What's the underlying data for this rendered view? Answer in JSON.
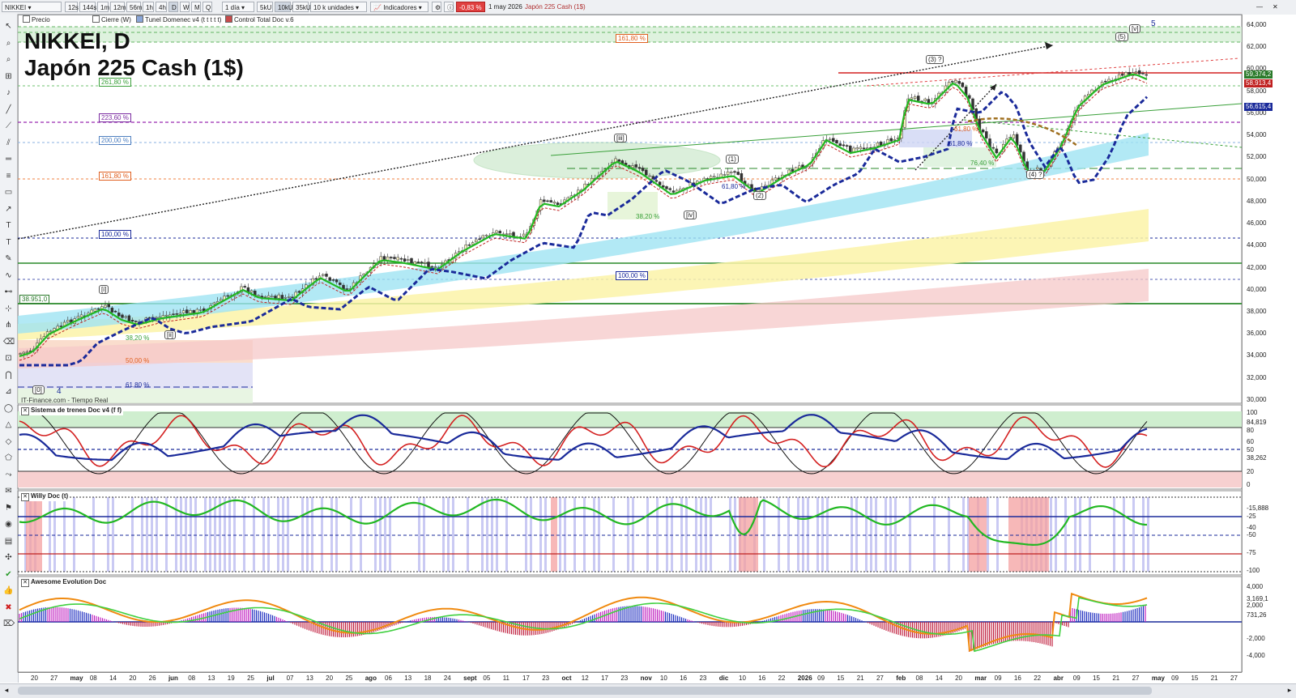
{
  "toolbar": {
    "symbol": "NIKKEI",
    "intervals": [
      "12s",
      "144s",
      "1m",
      "12m",
      "56m",
      "1h",
      "4h",
      "D",
      "W",
      "M",
      "Q"
    ],
    "period": "1 día",
    "units": [
      "5kU",
      "10kU",
      "35kU"
    ],
    "unit_select": "10 k unidades",
    "indicators_label": "Indicadores",
    "change": "-0,83 %",
    "date": "1 may 2026",
    "instrument": "Japón 225 Cash (1$)"
  },
  "legend": {
    "items": [
      "Precio",
      "Cierre (W)",
      "Tunel Domenec v4 (t t t t t)",
      "Control Total Doc v.6"
    ]
  },
  "chart_title": {
    "line1": "NIKKEI, D",
    "line2": "Japón 225 Cash (1$)"
  },
  "source": "IT-Finance.com - Tiempo Real",
  "panels": {
    "trains": "Sistema de trenes Doc v4 (f f)",
    "willy": "Willy Doc (t)",
    "awesome": "Awesome Evolution Doc"
  },
  "right_axis": {
    "price_ticks": [
      "64,000",
      "62,000",
      "60,000",
      "58,000",
      "56,000",
      "54,000",
      "52,000",
      "50,000",
      "48,000",
      "46,000",
      "44,000",
      "42,000",
      "40,000",
      "38,000",
      "36,000",
      "34,000",
      "32,000",
      "30,000"
    ],
    "price_tags": [
      {
        "text": "59,374,2",
        "color": "#ffffff",
        "bg": "#2a7a2a"
      },
      {
        "text": "58,913,4",
        "color": "#ffffff",
        "bg": "#c02020"
      },
      {
        "text": "56,615,4",
        "color": "#ffffff",
        "bg": "#1a2a9a"
      }
    ],
    "trains_ticks": [
      "100",
      "84,819",
      "80",
      "60",
      "50",
      "38,262",
      "20",
      "0"
    ],
    "willy_ticks": [
      "-15,888",
      "-25",
      "-40",
      "-50",
      "-75",
      "-100"
    ],
    "awesome_ticks": [
      "4,000",
      "3,169,1",
      "2,000",
      "731,26",
      "-2,000",
      "-4,000"
    ]
  },
  "left_labels": {
    "level_38951": "38.951,0"
  },
  "fib_labels": [
    "161,80 %",
    "261,80 %",
    "223,60 %",
    "200,00 %",
    "161,80 %",
    "100,00 %",
    "100,00 %",
    "38,20 %",
    "50,00 %",
    "61,80 %",
    "61,80 %",
    "38,20 %",
    "61,80 %",
    "76,40 %",
    "61,80 %"
  ],
  "wave_labels": [
    "[i]",
    "[ii]",
    "[iii]",
    "[iv]",
    "(1)",
    "(2)",
    "(3) ?",
    "(4) ?",
    "(5)",
    "[v]",
    "5",
    "[0]",
    "4"
  ],
  "x_axis": {
    "labels": [
      "20",
      "27",
      "may",
      "08",
      "14",
      "20",
      "26",
      "jun",
      "08",
      "13",
      "19",
      "25",
      "jul",
      "07",
      "13",
      "20",
      "25",
      "ago",
      "06",
      "13",
      "18",
      "24",
      "sept",
      "05",
      "11",
      "17",
      "23",
      "oct",
      "12",
      "17",
      "23",
      "nov",
      "10",
      "16",
      "23",
      "dic",
      "10",
      "16",
      "22",
      "2026",
      "09",
      "15",
      "21",
      "27",
      "feb",
      "08",
      "14",
      "20",
      "mar",
      "09",
      "16",
      "22",
      "abr",
      "09",
      "15",
      "21",
      "27",
      "may",
      "09",
      "15",
      "21",
      "27"
    ],
    "bold": [
      "may",
      "jun",
      "jul",
      "ago",
      "sept",
      "oct",
      "nov",
      "dic",
      "2026",
      "feb",
      "mar",
      "abr",
      "may"
    ]
  },
  "colors": {
    "bull": "#1aa01a",
    "bear": "#d42020",
    "ma_blue": "#1a2a9a",
    "fib_green": "#6cc26c",
    "cloud_cyan": "#9fe3f2",
    "cloud_yellow": "#fbf3a8",
    "cloud_pink": "#f6c8c8"
  }
}
